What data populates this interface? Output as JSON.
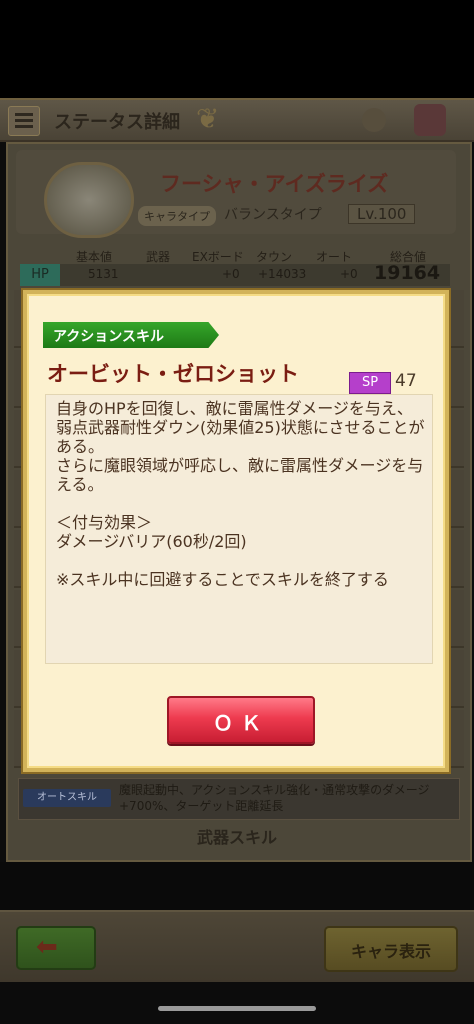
{
  "header": {
    "title": "ステータス詳細"
  },
  "character": {
    "name": "フーシャ・アイズライズ",
    "type_label": "キャラタイプ",
    "type_value": "バランスタイプ",
    "level": "Lv.100"
  },
  "stats": {
    "headers": [
      "基本値",
      "武器",
      "EXボード",
      "タウン",
      "オート",
      "総合値"
    ],
    "hp": {
      "label": "HP",
      "base": "5131",
      "exboard": "+0",
      "town": "+14033",
      "auto": "+0",
      "total": "19164"
    }
  },
  "auto_skill": {
    "label": "オートスキル",
    "text": "魔眼起動中、アクションスキル強化・通常攻撃のダメージ+700%、ターゲット距離延長"
  },
  "weapon_skill_label": "武器スキル",
  "bottom": {
    "char_button": "キャラ表示"
  },
  "modal": {
    "tag": "アクションスキル",
    "skill_name": "オービット・ゼロショット",
    "sp_label": "SP",
    "sp_value": "47",
    "description": "自身のHPを回復し、敵に雷属性ダメージを与え、弱点武器耐性ダウン(効果値25)状態にさせることがある。\nさらに魔眼領域が呼応し、敵に雷属性ダメージを与える。\n\n＜付与効果＞\nダメージバリア(60秒/2回)\n\n※スキル中に回避することでスキルを終了する",
    "ok_label": "ＯＫ"
  }
}
